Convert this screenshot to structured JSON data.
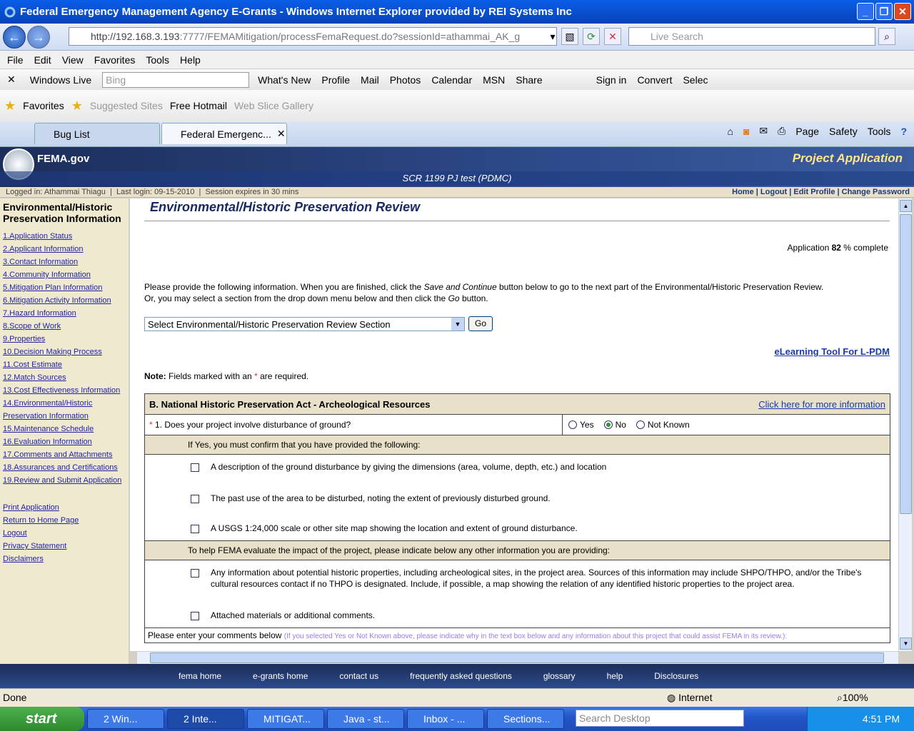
{
  "window": {
    "title": "Federal Emergency Management Agency E-Grants - Windows Internet Explorer provided by REI Systems Inc"
  },
  "address": {
    "url_host": "http://192.168.3.193",
    "url_rest": ":7777/FEMAMitigation/processFemaRequest.do?sessionId=athammai_AK_g",
    "search_placeholder": "Live Search"
  },
  "menu": [
    "File",
    "Edit",
    "View",
    "Favorites",
    "Tools",
    "Help"
  ],
  "wl_toolbar": {
    "brand": "Windows Live",
    "bing_placeholder": "Bing",
    "links": [
      "What's New",
      "Profile",
      "Mail",
      "Photos",
      "Calendar",
      "MSN",
      "Share"
    ],
    "signin": "Sign in",
    "convert": "Convert",
    "select": "Selec"
  },
  "favorites_bar": {
    "favorites": "Favorites",
    "items": [
      "Suggested Sites",
      "Free Hotmail",
      "Web Slice Gallery"
    ]
  },
  "tabs": [
    {
      "label": "Bug List"
    },
    {
      "label": "Federal Emergenc..."
    }
  ],
  "command_bar": [
    "Page",
    "Safety",
    "Tools"
  ],
  "header": {
    "site": "FEMA.gov",
    "app": "Project Application",
    "project": "SCR 1199 PJ test (PDMC)"
  },
  "session": {
    "logged_in": "Logged in: Athammai Thiagu",
    "last_login": "Last login: 09-15-2010",
    "expires": "Session expires in 30 mins",
    "links": [
      "Home",
      "Logout",
      "Edit Profile",
      "Change Password"
    ]
  },
  "sidebar": {
    "title": "Environmental/Historic Preservation Information",
    "items": [
      "1.Application Status",
      "2.Applicant Information",
      "3.Contact Information",
      "4.Community Information",
      "5.Mitigation Plan Information",
      "6.Mitigation Activity Information",
      "7.Hazard Information",
      "8.Scope of Work",
      "9.Properties",
      "10.Decision Making Process",
      "11.Cost Estimate",
      "12.Match Sources",
      "13.Cost Effectiveness Information",
      "14.Environmental/Historic Preservation Information",
      "15.Maintenance Schedule",
      "16.Evaluation Information",
      "17.Comments and Attachments",
      "18.Assurances and Certifications",
      "19.Review and Submit Application"
    ],
    "extra": [
      "Print Application",
      "Return to Home Page",
      "Logout",
      "Privacy Statement",
      "Disclaimers"
    ]
  },
  "main": {
    "title": "Environmental/Historic Preservation Review",
    "pct_prefix": "Application",
    "pct_value": "82",
    "pct_suffix": "% complete",
    "intro_1": "Please provide the following information. When you are finished, click the",
    "intro_save": "Save and Continue",
    "intro_2": "button below to go to the next part of the Environmental/Historic Preservation Review.",
    "intro_3": "Or, you may select a section from the drop down menu below and then click the",
    "intro_go": "Go",
    "intro_4": "button.",
    "select_value": "Select Environmental/Historic Preservation Review Section",
    "go_button": "Go",
    "elearning": "eLearning Tool For L-PDM",
    "note_label": "Note:",
    "note_1": "Fields marked with an",
    "note_star": "*",
    "note_2": "are required."
  },
  "section": {
    "title": "B. National Historic Preservation Act - Archeological Resources",
    "more_info": "Click here for more information",
    "question": "1. Does your project involve disturbance of ground?",
    "options": [
      "Yes",
      "No",
      "Not Known"
    ],
    "selected": "No",
    "confirm_bar": "If Yes, you must confirm that you have provided the following:",
    "confirm_items": [
      "A description of the ground disturbance by giving the dimensions (area, volume, depth, etc.) and location",
      "The past use of the area to be disturbed, noting the extent of previously disturbed ground.",
      "A USGS 1:24,000 scale or other site map showing the location and extent of ground disturbance."
    ],
    "help_bar": "To help FEMA evaluate the impact of the project, please indicate below any other information you are providing:",
    "help_items": [
      "Any information about potential historic properties, including archeological sites, in the project area. Sources of this information may include SHPO/THPO, and/or the Tribe's cultural resources contact if no THPO is designated. Include, if possible, a map showing the relation of any identified historic properties to the project area.",
      "Attached materials or additional comments."
    ],
    "comments_label": "Please enter your comments below",
    "comments_hint": "(If you selected Yes or Not Known above, please indicate why in the text box below and any information about this project that could assist FEMA in its review.):"
  },
  "footer": [
    "fema home",
    "e-grants home",
    "contact us",
    "frequently asked questions",
    "glossary",
    "help",
    "Disclosures"
  ],
  "status": {
    "left": "Done",
    "zone": "Internet",
    "zoom": "100%"
  },
  "taskbar": {
    "start": "start",
    "items": [
      "2 Win...",
      "2 Inte...",
      "MITIGAT...",
      "Java - st...",
      "Inbox - ...",
      "Sections..."
    ],
    "search_placeholder": "Search Desktop",
    "clock": "4:51 PM"
  }
}
